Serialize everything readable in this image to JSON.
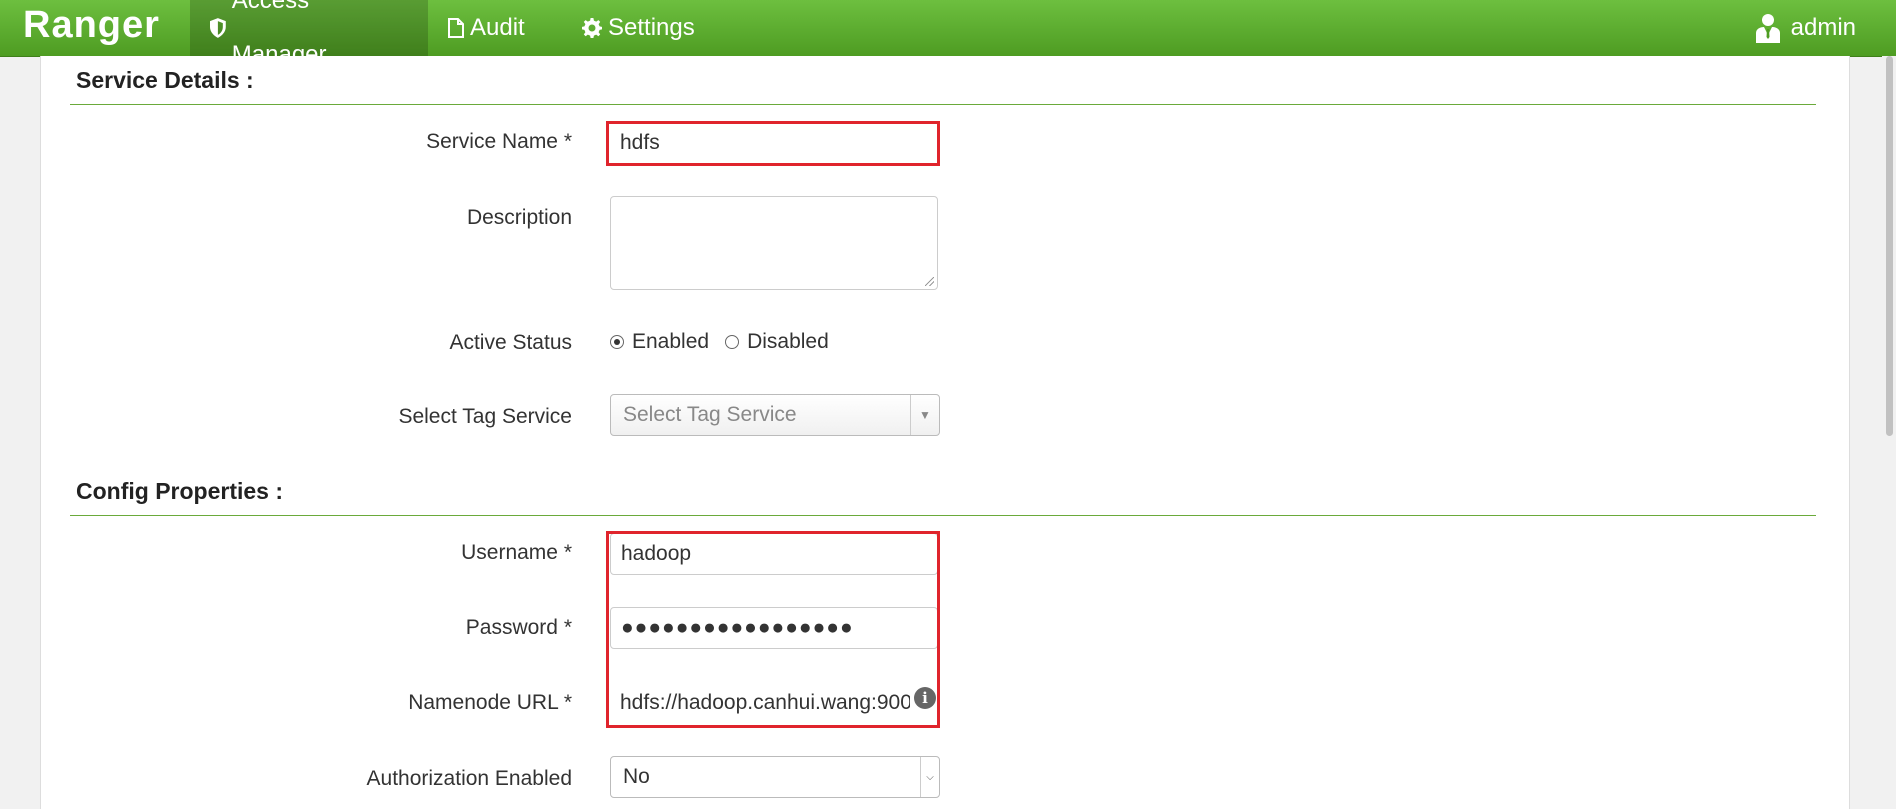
{
  "nav": {
    "brand": "Ranger",
    "items": [
      {
        "label": "Access Manager",
        "icon": "shield-icon",
        "active": true
      },
      {
        "label": "Audit",
        "icon": "file-icon",
        "active": false
      },
      {
        "label": "Settings",
        "icon": "gear-icon",
        "active": false
      }
    ],
    "user": {
      "label": "admin",
      "icon": "user-icon"
    }
  },
  "service_details": {
    "title": "Service Details :",
    "service_name": {
      "label": "Service Name *",
      "value": "hdfs"
    },
    "description": {
      "label": "Description",
      "value": ""
    },
    "active_status": {
      "label": "Active Status",
      "options": [
        "Enabled",
        "Disabled"
      ],
      "selected": "Enabled"
    },
    "tag_service": {
      "label": "Select Tag Service",
      "placeholder": "Select Tag Service"
    }
  },
  "config_properties": {
    "title": "Config Properties :",
    "username": {
      "label": "Username *",
      "value": "hadoop"
    },
    "password": {
      "label": "Password *",
      "value": "●●●●●●●●●●●●●●●●●"
    },
    "namenode_url": {
      "label": "Namenode URL *",
      "value": "hdfs://hadoop.canhui.wang:900"
    },
    "authorization_enabled": {
      "label": "Authorization Enabled",
      "value": "No"
    }
  },
  "colors": {
    "navbar": "#5aaa2e",
    "highlight": "#e0242c",
    "rule": "#6aaa3a"
  }
}
